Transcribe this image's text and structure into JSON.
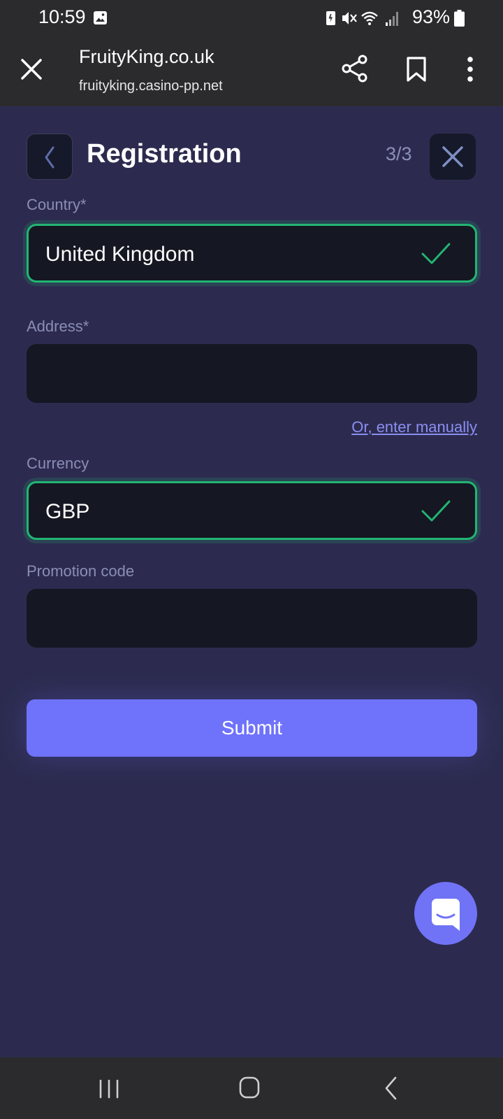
{
  "status_bar": {
    "time": "10:59",
    "battery": "93%"
  },
  "browser": {
    "title": "FruityKing.co.uk",
    "url": "fruityking.casino-pp.net"
  },
  "form": {
    "title": "Registration",
    "step": "3/3",
    "country_label": "Country*",
    "country_value": "United Kingdom",
    "address_label": "Address*",
    "address_value": "",
    "manual_link": "Or, enter manually",
    "currency_label": "Currency",
    "currency_value": "GBP",
    "promo_label": "Promotion code",
    "promo_value": "",
    "submit_label": "Submit"
  },
  "colors": {
    "background": "#2c2b4f",
    "field": "#151722",
    "valid_border": "#22b573",
    "accent": "#6f72fb",
    "label": "#8b8db5"
  }
}
